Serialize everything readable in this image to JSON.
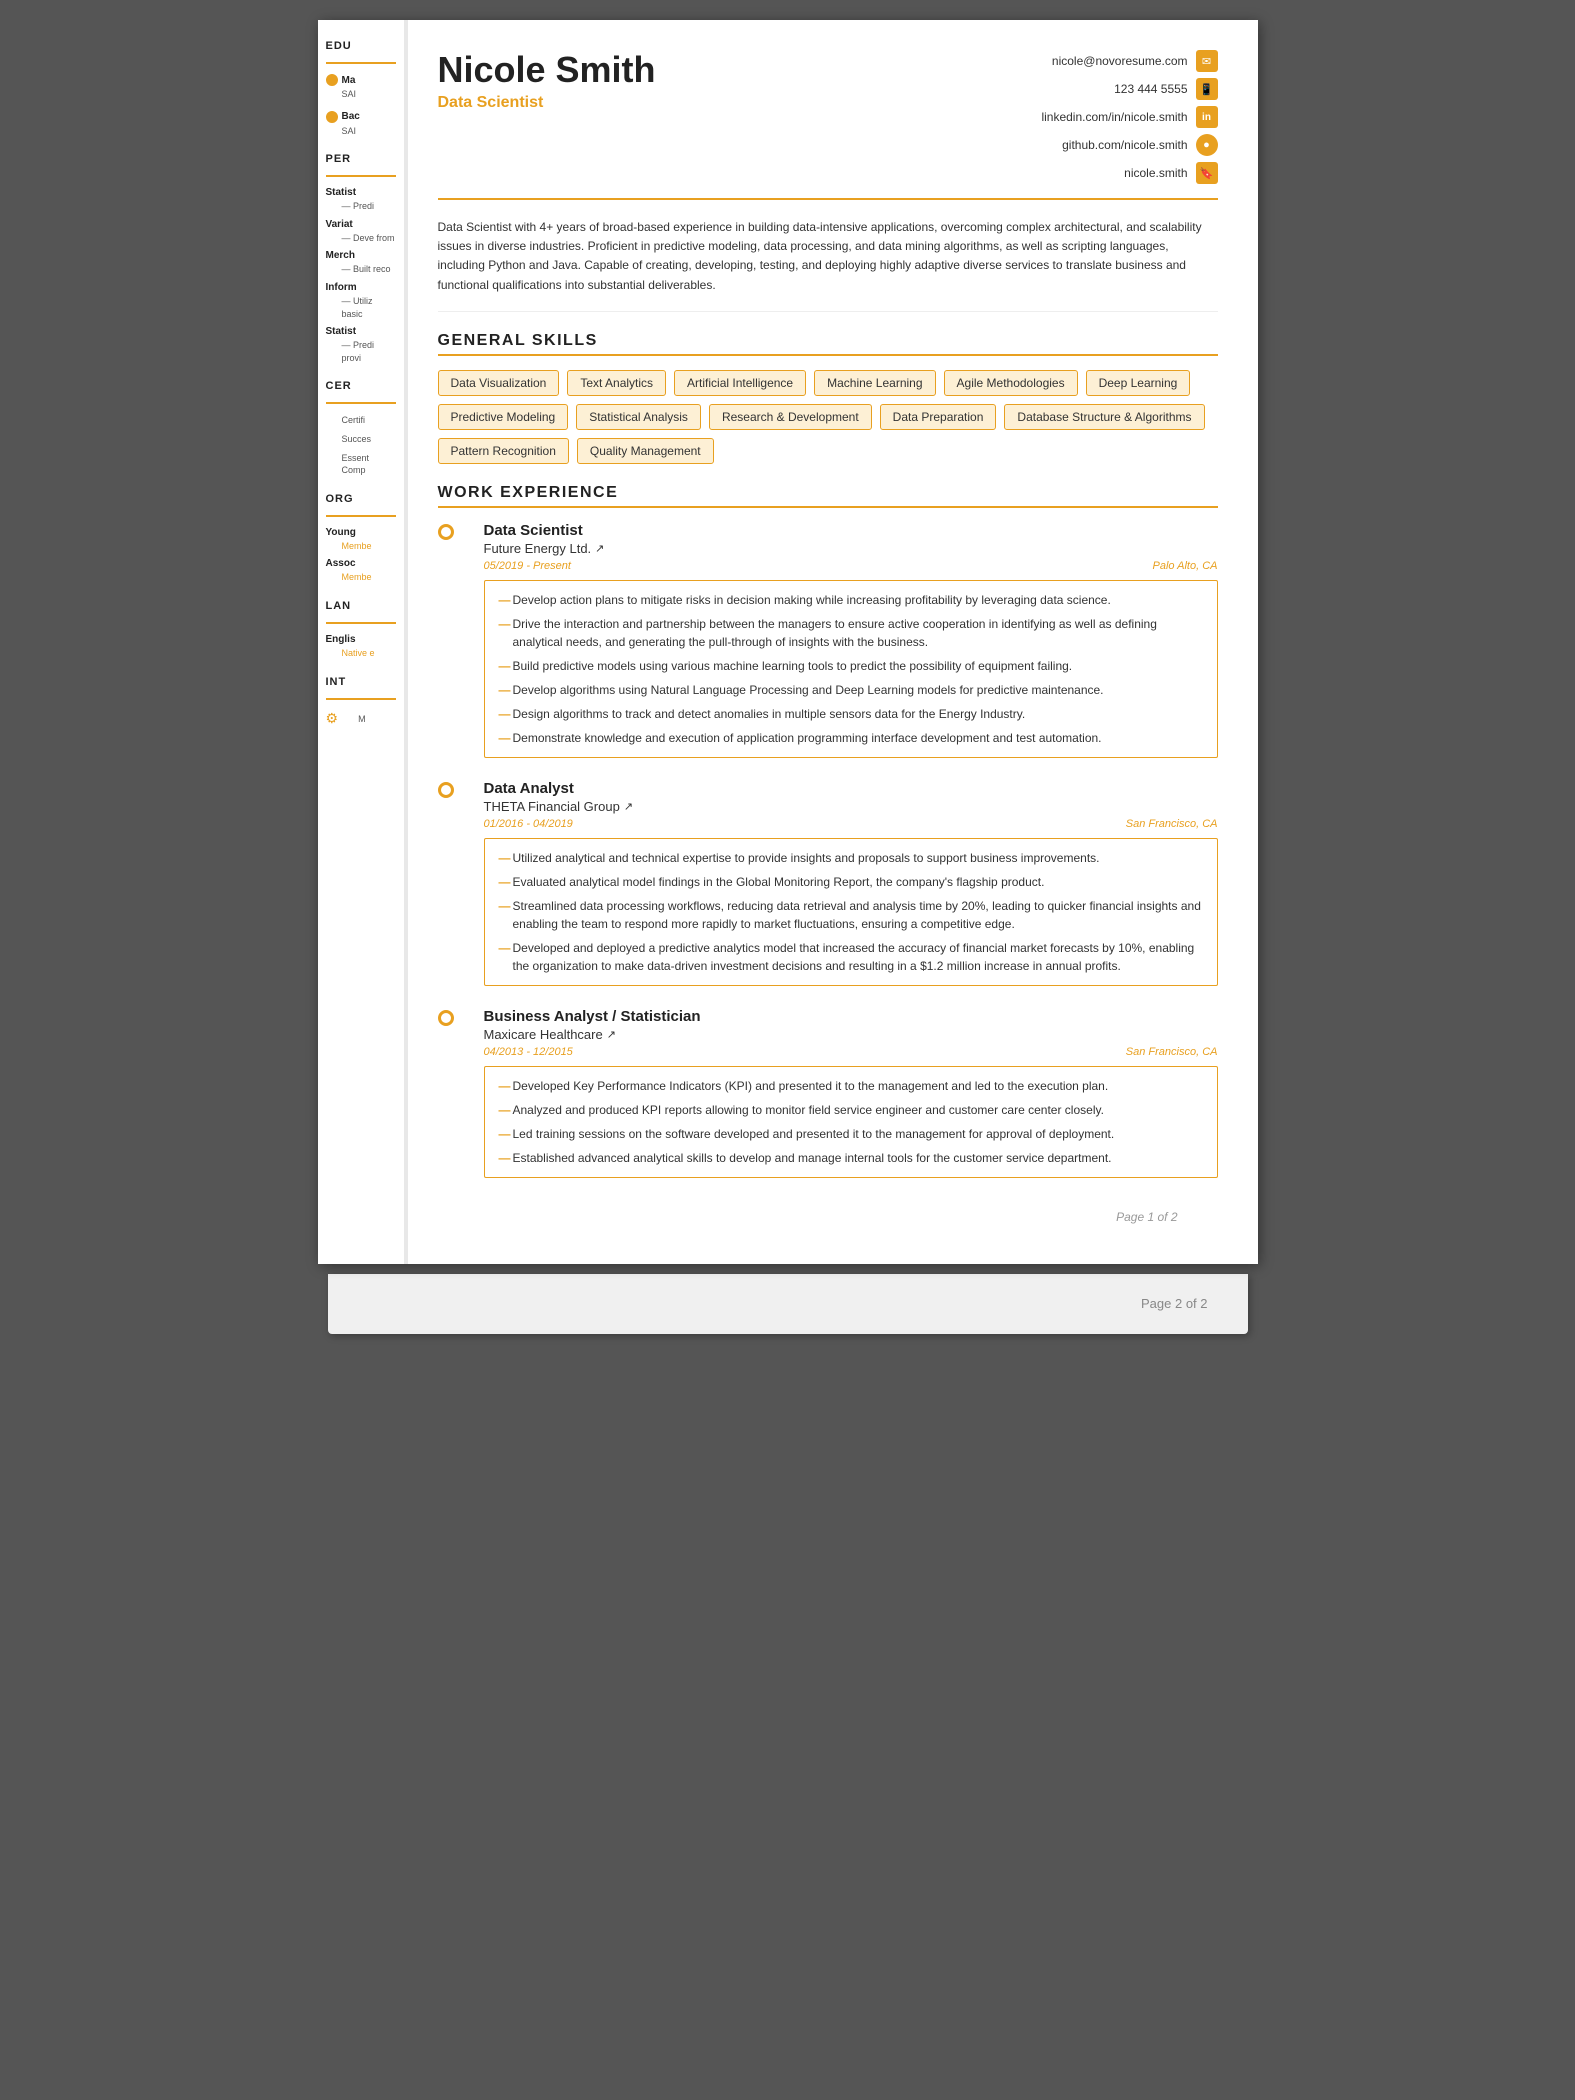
{
  "header": {
    "name": "Nicole Smith",
    "title": "Data Scientist",
    "contact": {
      "email": "nicole@novoresume.com",
      "phone": "123 444 5555",
      "linkedin": "linkedin.com/in/nicole.smith",
      "github": "github.com/nicole.smith",
      "portfolio": "nicole.smith"
    }
  },
  "summary": "Data Scientist with 4+ years of broad-based experience in building data-intensive applications, overcoming complex architectural, and scalability issues in diverse industries. Proficient in predictive modeling, data processing, and data mining algorithms, as well as scripting languages, including Python and Java. Capable of creating, developing, testing, and deploying highly adaptive diverse services to translate business and functional qualifications into substantial deliverables.",
  "sections": {
    "general_skills": {
      "title": "GENERAL SKILLS",
      "skills": [
        "Data Visualization",
        "Text Analytics",
        "Artificial Intelligence",
        "Machine Learning",
        "Agile Methodologies",
        "Deep Learning",
        "Predictive Modeling",
        "Statistical Analysis",
        "Research & Development",
        "Data Preparation",
        "Database Structure & Algorithms",
        "Pattern Recognition",
        "Quality Management"
      ]
    },
    "work_experience": {
      "title": "WORK EXPERIENCE",
      "jobs": [
        {
          "title": "Data Scientist",
          "company": "Future Energy Ltd.",
          "dates": "05/2019 - Present",
          "location": "Palo Alto, CA",
          "bullets": [
            "Develop action plans to mitigate risks in decision making while increasing profitability by leveraging data science.",
            "Drive the interaction and partnership between the managers to ensure active cooperation in identifying as well as defining analytical needs, and generating the pull-through of insights with the business.",
            "Build predictive models using various machine learning tools to predict the possibility of equipment failing.",
            "Develop algorithms using Natural Language Processing and Deep Learning models for predictive maintenance.",
            "Design algorithms to track and detect anomalies in multiple sensors data for the Energy Industry.",
            "Demonstrate knowledge and execution of application programming interface development and test automation."
          ]
        },
        {
          "title": "Data Analyst",
          "company": "THETA Financial Group",
          "dates": "01/2016 - 04/2019",
          "location": "San Francisco, CA",
          "bullets": [
            "Utilized analytical and technical expertise to provide insights and proposals to support business improvements.",
            "Evaluated analytical model findings in the Global Monitoring Report, the company's flagship product.",
            "Streamlined data processing workflows, reducing data retrieval and analysis time by 20%, leading to quicker financial insights and enabling the team to respond more rapidly to market fluctuations, ensuring a competitive edge.",
            "Developed and deployed a predictive analytics model that increased the accuracy of financial market forecasts by 10%, enabling the organization to make data-driven investment decisions and resulting in a $1.2 million increase in annual profits."
          ]
        },
        {
          "title": "Business Analyst / Statistician",
          "company": "Maxicare Healthcare",
          "dates": "04/2013 - 12/2015",
          "location": "San Francisco, CA",
          "bullets": [
            "Developed Key Performance Indicators (KPI) and presented it to the management and led to the execution plan.",
            "Analyzed and produced KPI reports allowing to monitor field service engineer and customer care center closely.",
            "Led training sessions on the software developed and presented it to the management for approval of deployment.",
            "Established advanced analytical skills to develop and manage internal tools for the customer service department."
          ]
        }
      ]
    }
  },
  "sidebar": {
    "education": {
      "title": "EDU",
      "items": [
        {
          "degree": "Ma",
          "school": "SAI",
          "detail": ""
        },
        {
          "degree": "Bac",
          "school": "SAI",
          "detail": ""
        }
      ]
    },
    "personal": {
      "title": "PER",
      "items": [
        {
          "label": "Statist",
          "sub": "Predi"
        },
        {
          "label": "Variat",
          "sub": "Deve from"
        },
        {
          "label": "Merch",
          "sub": "Built reco"
        },
        {
          "label": "Inform",
          "sub": "Utiliz basic"
        },
        {
          "label": "Statist",
          "sub": "Predi provi"
        }
      ]
    },
    "certifications": {
      "title": "CER",
      "items": [
        {
          "label": "Certifi"
        },
        {
          "label": "Succes"
        },
        {
          "label": "Essent Comp"
        }
      ]
    },
    "organizations": {
      "title": "ORG",
      "items": [
        {
          "label": "Young",
          "sub": "Membe"
        },
        {
          "label": "Assoc",
          "sub": "Membe"
        }
      ]
    },
    "languages": {
      "title": "LAN",
      "items": [
        {
          "label": "Englis",
          "sub": "Native e"
        }
      ]
    },
    "interests": {
      "title": "INT",
      "items": [
        {
          "label": "M"
        }
      ]
    }
  },
  "page_number": "Page 1 of 2",
  "page2_number": "Page 2 of 2"
}
